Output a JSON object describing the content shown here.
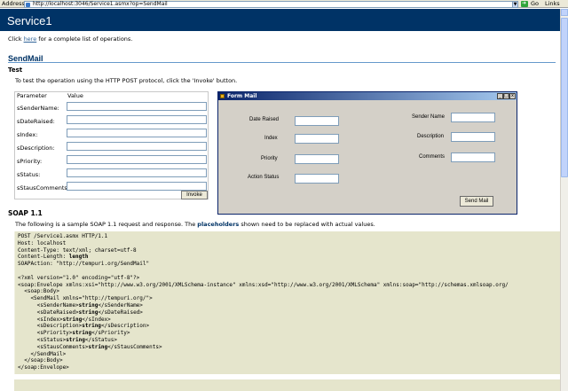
{
  "browser": {
    "address_label": "Address",
    "url": "http://localhost:3046/Service1.asmx?op=SendMail",
    "go_label": "Go",
    "links_label": "Links"
  },
  "page": {
    "title": "Service1",
    "intro_prefix": "Click ",
    "intro_link": "here",
    "intro_suffix": " for a complete list of operations.",
    "operation": "SendMail",
    "test_heading": "Test",
    "test_desc": "To test the operation using the HTTP POST protocol, click the 'Invoke' button."
  },
  "param_form": {
    "header_param": "Parameter",
    "header_value": "Value",
    "params": [
      {
        "label": "sSenderName:",
        "value": ""
      },
      {
        "label": "sDateRaised:",
        "value": ""
      },
      {
        "label": "sIndex:",
        "value": ""
      },
      {
        "label": "sDescription:",
        "value": ""
      },
      {
        "label": "sPriority:",
        "value": ""
      },
      {
        "label": "sStatus:",
        "value": ""
      },
      {
        "label": "sStausComments:",
        "value": ""
      }
    ],
    "invoke_label": "Invoke"
  },
  "form_mail": {
    "title": "Form Mail",
    "controls": {
      "min": "_",
      "max": "□",
      "close": "x"
    },
    "fields": {
      "date_raised": "Date Raised",
      "index": "Index",
      "priority": "Priority",
      "action_status": "Action Status",
      "sender_name": "Sender Name",
      "description": "Description",
      "comments": "Comments"
    },
    "send_label": "Send Mail"
  },
  "soap": {
    "heading": "SOAP 1.1",
    "desc_prefix": "The following is a sample SOAP 1.1 request and response. The ",
    "desc_bold": "placeholders",
    "desc_suffix": " shown need to be replaced with actual values.",
    "line1": "POST /Service1.asmx HTTP/1.1",
    "line2": "Host: localhost",
    "line3": "Content-Type: text/xml; charset=utf-8",
    "line4_prefix": "Content-Length: ",
    "line4_bold": "length",
    "line5": "SOAPAction: \"http://tempuri.org/SendMail\"",
    "line7": "<?xml version=\"1.0\" encoding=\"utf-8\"?>",
    "line8": "<soap:Envelope xmlns:xsi=\"http://www.w3.org/2001/XMLSchema-instance\" xmlns:xsd=\"http://www.w3.org/2001/XMLSchema\" xmlns:soap=\"http://schemas.xmlsoap.org/",
    "line9": "  <soap:Body>",
    "line10": "    <SendMail xmlns=\"http://tempuri.org/\">",
    "params": [
      {
        "open": "      <sSenderName>",
        "type": "string",
        "close": "</sSenderName>"
      },
      {
        "open": "      <sDateRaised>",
        "type": "string",
        "close": "</sDateRaised>"
      },
      {
        "open": "      <sIndex>",
        "type": "string",
        "close": "</sIndex>"
      },
      {
        "open": "      <sDescription>",
        "type": "string",
        "close": "</sDescription>"
      },
      {
        "open": "      <sPriority>",
        "type": "string",
        "close": "</sPriority>"
      },
      {
        "open": "      <sStatus>",
        "type": "string",
        "close": "</sStatus>"
      },
      {
        "open": "      <sStausComments>",
        "type": "string",
        "close": "</sStausComments>"
      }
    ],
    "line18": "    </SendMail>",
    "line19": "  </soap:Body>",
    "line20": "</soap:Envelope>"
  }
}
